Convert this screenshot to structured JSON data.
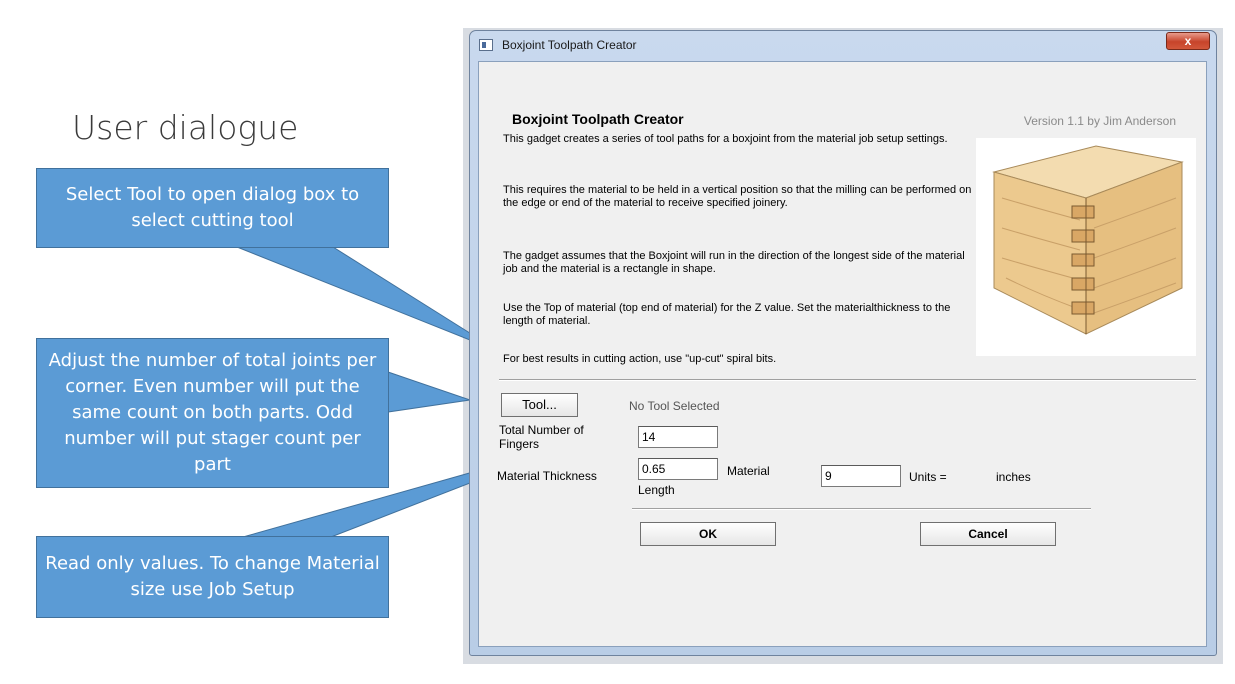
{
  "slide": {
    "title": "User dialogue",
    "callouts": [
      "Select Tool to open dialog box to select cutting tool",
      "Adjust the number of total joints per corner. Even number will put the same count on both parts. Odd number will put stager count per part",
      "Read only values. To change Material size use Job Setup"
    ]
  },
  "window": {
    "title": "Boxjoint Toolpath Creator",
    "close_label": "x"
  },
  "dialog": {
    "header_title": "Boxjoint Toolpath Creator",
    "version": "Version 1.1 by Jim Anderson",
    "paragraphs": [
      "This gadget creates a series of tool paths for a boxjoint from the material job setup settings.",
      "This requires the material to be held in a vertical position so that the milling can be performed on the edge or end of the material to receive specified joinery.",
      "The gadget assumes that the Boxjoint will run in the direction of the longest side of the material job and the material is a rectangle in shape.",
      "Use the Top of material (top end of material) for the Z value. Set the materialthickness to the length of material.",
      "For best results in cutting action, use \"up-cut\" spiral bits."
    ],
    "tool_button": "Tool...",
    "tool_status": "No Tool Selected",
    "fingers_label": "Total Number of Fingers",
    "fingers_value": "14",
    "thickness_label": "Material Thickness",
    "thickness_value": "0.65",
    "length_label_1": "Material",
    "length_label_2": "Length",
    "length_value": "9",
    "units_label": "Units =",
    "units_value": "inches",
    "ok_label": "OK",
    "cancel_label": "Cancel"
  },
  "colors": {
    "callout_fill": "#5b9bd5",
    "callout_border": "#41719c"
  }
}
